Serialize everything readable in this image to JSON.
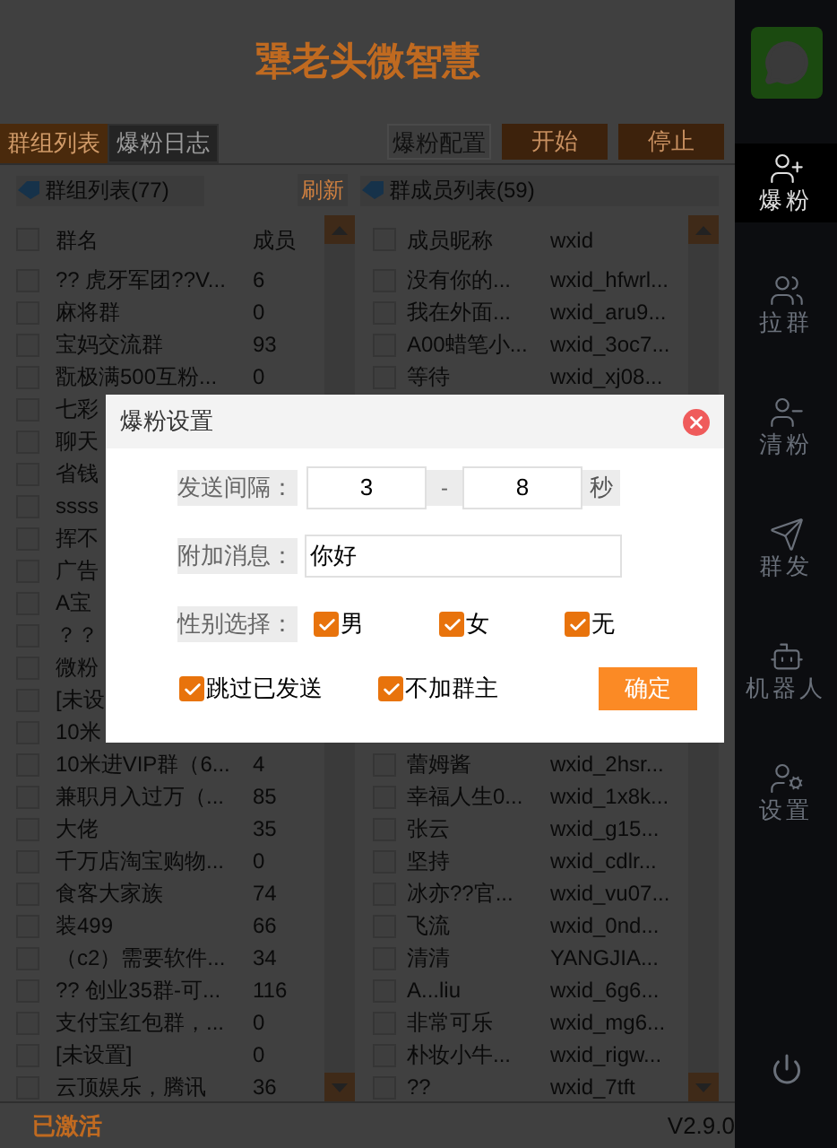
{
  "app": {
    "title": "犟老头微智慧"
  },
  "tabs": [
    {
      "label": "群组列表",
      "selected": true
    },
    {
      "label": "爆粉日志",
      "selected": false
    }
  ],
  "toolbar": {
    "config_button": "爆粉配置",
    "start_button": "开始",
    "stop_button": "停止"
  },
  "groups_panel": {
    "title": "群组列表(77)",
    "refresh": "刷新",
    "columns": [
      "群名",
      "成员"
    ],
    "select_all_checked": false,
    "rows": [
      {
        "name": "?? 虎牙军团??V...",
        "members": "6",
        "checked": false
      },
      {
        "name": "麻将群",
        "members": "0",
        "checked": false
      },
      {
        "name": "宝妈交流群",
        "members": "93",
        "checked": false
      },
      {
        "name": "翫极满500互粉...",
        "members": "0",
        "checked": false
      },
      {
        "name": "七彩",
        "checked": false
      },
      {
        "name": "聊天",
        "checked": false
      },
      {
        "name": "省钱",
        "checked": false
      },
      {
        "name": "ssss",
        "checked": false
      },
      {
        "name": "挥不",
        "checked": false
      },
      {
        "name": "广告",
        "checked": false
      },
      {
        "name": "A宝",
        "checked": false
      },
      {
        "name": "？？",
        "checked": false
      },
      {
        "name": "微粉",
        "checked": false
      },
      {
        "name": "[未设",
        "checked": false
      },
      {
        "name": "10米",
        "checked": false
      },
      {
        "name": "10米进VIP群（6...",
        "members": "4",
        "checked": false
      },
      {
        "name": "兼职月入过万（...",
        "members": "85",
        "checked": false
      },
      {
        "name": "大佬",
        "members": "35",
        "checked": false
      },
      {
        "name": "千万店淘宝购物...",
        "members": "0",
        "checked": false
      },
      {
        "name": "食客大家族",
        "members": "74",
        "checked": false
      },
      {
        "name": "装499",
        "members": "66",
        "checked": false
      },
      {
        "name": "（c2）需要软件...",
        "members": "34",
        "checked": false
      },
      {
        "name": "?? 创业35群-可...",
        "members": "116",
        "checked": false
      },
      {
        "name": "支付宝红包群，...",
        "members": "0",
        "checked": false
      },
      {
        "name": "[未设置]",
        "members": "0",
        "checked": false
      },
      {
        "name": "云顶娱乐，腾讯",
        "members": "36",
        "checked": false
      }
    ]
  },
  "members_panel": {
    "title": "群成员列表(59)",
    "columns": [
      "成员昵称",
      "wxid"
    ],
    "select_all_checked": false,
    "rows_top": [
      {
        "nickname": "没有你的...",
        "wxid": "wxid_hfwrl...",
        "checked": false
      },
      {
        "nickname": "我在外面...",
        "wxid": "wxid_aru9...",
        "checked": false
      },
      {
        "nickname": "A00蜡笔小...",
        "wxid": "wxid_3oc7...",
        "checked": false
      },
      {
        "nickname": "等待",
        "wxid": "wxid_xj08...",
        "checked": false
      }
    ],
    "rows_bottom": [
      {
        "nickname": "蕾姆酱",
        "wxid": "wxid_2hsr...",
        "checked": false
      },
      {
        "nickname": "幸福人生0...",
        "wxid": "wxid_1x8k...",
        "checked": false
      },
      {
        "nickname": "张云",
        "wxid": "wxid_g15...",
        "checked": false
      },
      {
        "nickname": "坚持",
        "wxid": "wxid_cdlr...",
        "checked": false
      },
      {
        "nickname": "冰亦??官...",
        "wxid": "wxid_vu07...",
        "checked": false
      },
      {
        "nickname": "飞流",
        "wxid": "wxid_0nd...",
        "checked": false
      },
      {
        "nickname": "清清",
        "wxid": "YANGJIA...",
        "checked": false
      },
      {
        "nickname": "A...liu",
        "wxid": "wxid_6g6...",
        "checked": false
      },
      {
        "nickname": "非常可乐",
        "wxid": "wxid_mg6...",
        "checked": false
      },
      {
        "nickname": "朴妆小牛...",
        "wxid": "wxid_rigw...",
        "checked": false
      },
      {
        "nickname": "??",
        "wxid": "wxid_7tft",
        "checked": false
      }
    ]
  },
  "status_bar": {
    "status": "已激活",
    "version": "V2.9.0"
  },
  "sidebar": {
    "items": [
      {
        "label": "爆粉",
        "selected": true
      },
      {
        "label": "拉群",
        "selected": false
      },
      {
        "label": "清粉",
        "selected": false
      },
      {
        "label": "群发",
        "selected": false
      },
      {
        "label": "机器人",
        "selected": false
      },
      {
        "label": "设置",
        "selected": false
      }
    ]
  },
  "dialog": {
    "title": "爆粉设置",
    "interval_label": "发送间隔：",
    "interval_min": "3",
    "interval_dash": "-",
    "interval_max": "8",
    "interval_unit": "秒",
    "message_label": "附加消息：",
    "message": "你好",
    "gender_label": "性别选择：",
    "genders": [
      {
        "label": "男",
        "checked": true
      },
      {
        "label": "女",
        "checked": true
      },
      {
        "label": "无",
        "checked": true
      }
    ],
    "options": [
      {
        "label": "跳过已发送",
        "checked": true
      },
      {
        "label": "不加群主",
        "checked": true
      }
    ],
    "confirm_button": "确定"
  }
}
